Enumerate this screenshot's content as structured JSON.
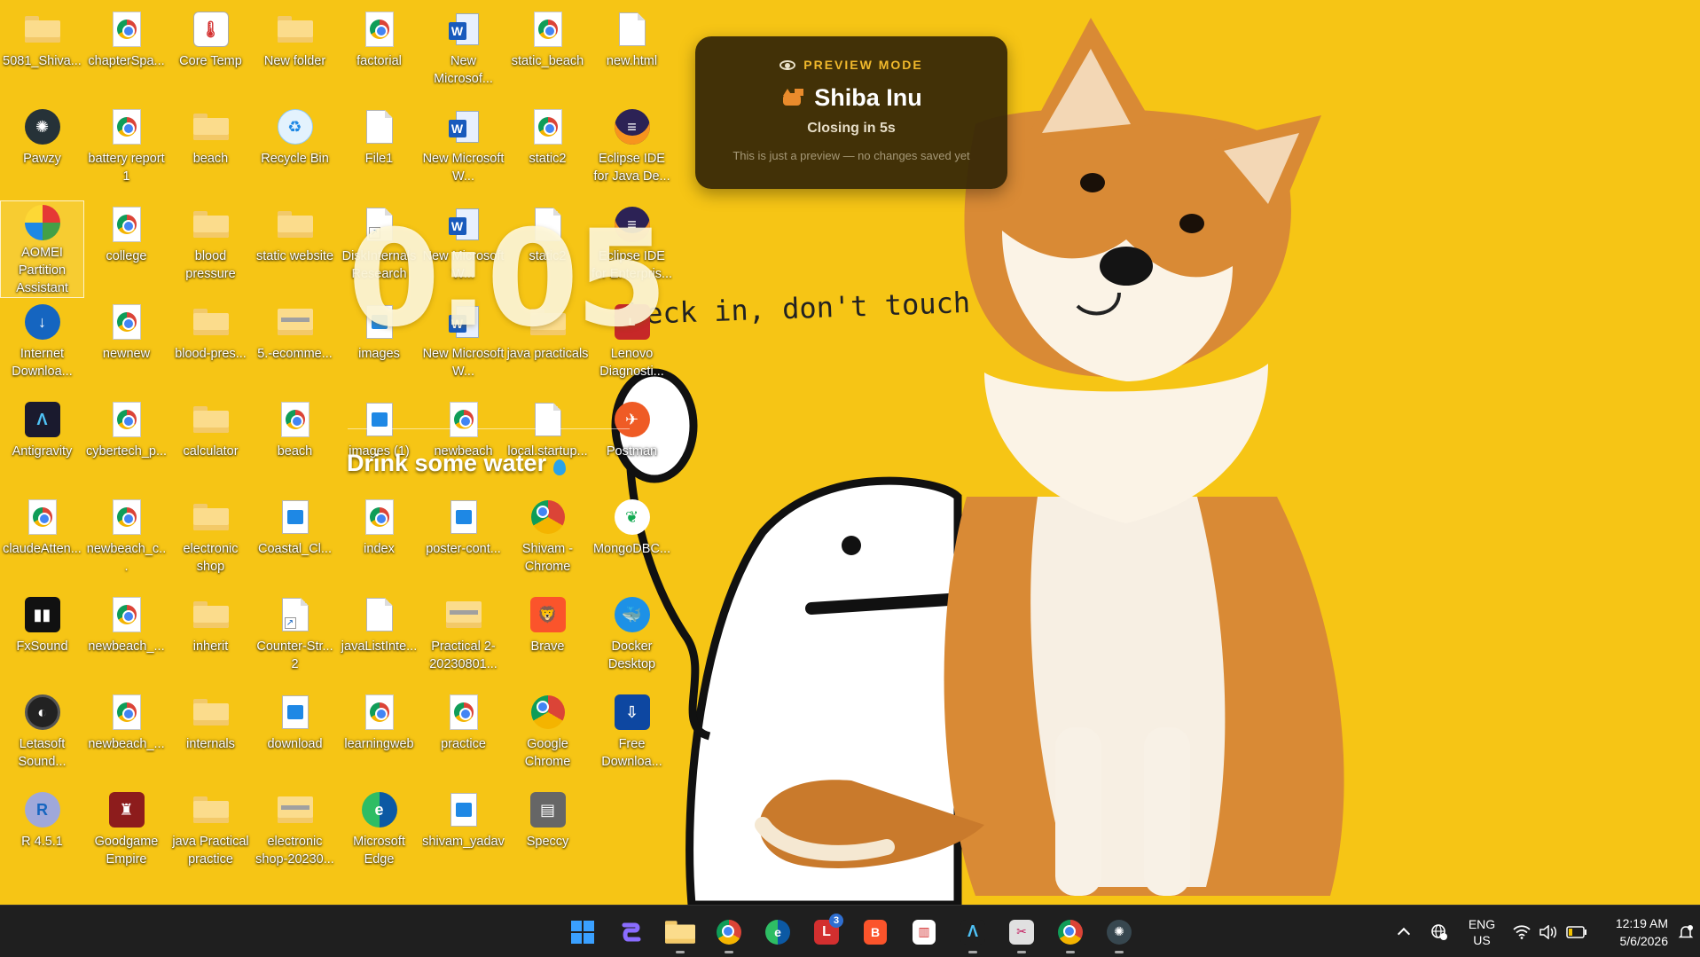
{
  "desktop": {
    "icons": [
      {
        "label": "5081_Shiva...",
        "glyph": "folder"
      },
      {
        "label": "chapterSpa...",
        "glyph": "chrome-doc"
      },
      {
        "label": "Core Temp",
        "glyph": "coretemp"
      },
      {
        "label": "New folder",
        "glyph": "folder"
      },
      {
        "label": "factorial",
        "glyph": "chrome-doc"
      },
      {
        "label": "New Microsof...",
        "glyph": "word"
      },
      {
        "label": "static_beach",
        "glyph": "chrome-doc"
      },
      {
        "label": "new.html",
        "glyph": "doc"
      },
      {
        "label": "Pawzy",
        "glyph": "pawzy"
      },
      {
        "label": "battery report 1",
        "glyph": "chrome-doc"
      },
      {
        "label": "beach",
        "glyph": "folder"
      },
      {
        "label": "Recycle Bin",
        "glyph": "recycle"
      },
      {
        "label": "File1",
        "glyph": "doc"
      },
      {
        "label": "New Microsoft W...",
        "glyph": "word"
      },
      {
        "label": "static2",
        "glyph": "chrome-doc"
      },
      {
        "label": "Eclipse IDE for Java De...",
        "glyph": "eclipse"
      },
      {
        "label": "AOMEI Partition Assistant 10.10.1",
        "glyph": "aomei",
        "selected": true
      },
      {
        "label": "college",
        "glyph": "chrome-doc"
      },
      {
        "label": "blood pressure",
        "glyph": "folder"
      },
      {
        "label": "static website",
        "glyph": "folder"
      },
      {
        "label": "DiskInternals Research",
        "glyph": "doc-link"
      },
      {
        "label": "New Microsoft W...",
        "glyph": "word"
      },
      {
        "label": "static2",
        "glyph": "doc"
      },
      {
        "label": "Eclipse IDE for Enterpris...",
        "glyph": "eclipse"
      },
      {
        "label": "Internet Downloa...",
        "glyph": "idm"
      },
      {
        "label": "newnew",
        "glyph": "chrome-doc"
      },
      {
        "label": "blood-pres...",
        "glyph": "folder"
      },
      {
        "label": "5.-ecomme...",
        "glyph": "zip"
      },
      {
        "label": "images",
        "glyph": "img-doc"
      },
      {
        "label": "New Microsoft W...",
        "glyph": "word"
      },
      {
        "label": "java practicals",
        "glyph": "folder"
      },
      {
        "label": "Lenovo Diagnosti...",
        "glyph": "lenovo"
      },
      {
        "label": "Antigravity",
        "glyph": "antigravity"
      },
      {
        "label": "cybertech_p...",
        "glyph": "chrome-doc"
      },
      {
        "label": "calculator",
        "glyph": "folder"
      },
      {
        "label": "beach",
        "glyph": "chrome-doc"
      },
      {
        "label": "images (1)",
        "glyph": "img-doc"
      },
      {
        "label": "newbeach",
        "glyph": "chrome-doc"
      },
      {
        "label": "local.startup...",
        "glyph": "doc"
      },
      {
        "label": "Postman",
        "glyph": "postman"
      },
      {
        "label": "claudeAtten...",
        "glyph": "chrome-doc"
      },
      {
        "label": "newbeach_c...",
        "glyph": "chrome-doc"
      },
      {
        "label": "electronic shop",
        "glyph": "folder"
      },
      {
        "label": "Coastal_Cl...",
        "glyph": "img-doc"
      },
      {
        "label": "index",
        "glyph": "chrome-doc"
      },
      {
        "label": "poster-cont...",
        "glyph": "img-doc"
      },
      {
        "label": "Shivam - Chrome",
        "glyph": "chrome-app"
      },
      {
        "label": "MongoDBC...",
        "glyph": "mongo"
      },
      {
        "label": "FxSound",
        "glyph": "fxsound"
      },
      {
        "label": "newbeach_...",
        "glyph": "chrome-doc"
      },
      {
        "label": "inherit",
        "glyph": "folder"
      },
      {
        "label": "Counter-Str... 2",
        "glyph": "doc-link"
      },
      {
        "label": "javaListInte...",
        "glyph": "doc"
      },
      {
        "label": "Practical 2-20230801...",
        "glyph": "zip"
      },
      {
        "label": "Brave",
        "glyph": "brave"
      },
      {
        "label": "Docker Desktop",
        "glyph": "docker"
      },
      {
        "label": "Letasoft Sound...",
        "glyph": "letasoft"
      },
      {
        "label": "newbeach_...",
        "glyph": "chrome-doc"
      },
      {
        "label": "internals",
        "glyph": "folder"
      },
      {
        "label": "download",
        "glyph": "img-doc"
      },
      {
        "label": "learningweb",
        "glyph": "chrome-doc"
      },
      {
        "label": "practice",
        "glyph": "chrome-doc"
      },
      {
        "label": "Google Chrome",
        "glyph": "chrome-app"
      },
      {
        "label": "Free Downloa...",
        "glyph": "fdm"
      },
      {
        "label": "R 4.5.1",
        "glyph": "rlang"
      },
      {
        "label": "Goodgame Empire",
        "glyph": "goodgame"
      },
      {
        "label": "java Practical practice",
        "glyph": "folder"
      },
      {
        "label": "electronic shop-20230...",
        "glyph": "zip"
      },
      {
        "label": "Microsoft Edge",
        "glyph": "edge"
      },
      {
        "label": "shivam_yadav",
        "glyph": "img-doc"
      },
      {
        "label": "Speccy",
        "glyph": "speccy"
      }
    ]
  },
  "wallpaper": {
    "handwriting": "check in, don't touch a"
  },
  "overlay": {
    "clock": "0:05",
    "reminder": "Drink some water"
  },
  "preview": {
    "mode": "PREVIEW MODE",
    "title": "Shiba Inu",
    "closing": "Closing in 5s",
    "note": "This is just a preview — no changes saved yet"
  },
  "taskbar": {
    "apps": [
      {
        "name": "start-button",
        "icon": "windows-logo"
      },
      {
        "name": "copilot",
        "icon": "copilot-icon"
      },
      {
        "name": "file-explorer",
        "icon": "folder-icon",
        "running": true
      },
      {
        "name": "chrome-profile",
        "icon": "chrome-icon",
        "running": true
      },
      {
        "name": "edge",
        "icon": "edge-icon"
      },
      {
        "name": "lenovo-vantage",
        "icon": "lenovo-icon",
        "badge": "3"
      },
      {
        "name": "brave",
        "icon": "brave-icon"
      },
      {
        "name": "core-temp",
        "icon": "coretemp-icon"
      },
      {
        "name": "antigravity",
        "icon": "antigravity-icon",
        "running": true
      },
      {
        "name": "snipping-tool",
        "icon": "snipping-icon",
        "running": true
      },
      {
        "name": "chrome",
        "icon": "chrome-icon",
        "running": true
      },
      {
        "name": "pawzy",
        "icon": "pawzy-icon",
        "running": true
      }
    ],
    "tray": {
      "lang_top": "ENG",
      "lang_bottom": "US",
      "time": "12:19 AM",
      "date": "5/6/2026"
    }
  },
  "colors": {
    "wallpaper": "#f6c515",
    "taskbar": "#1f1f1f",
    "toast": "#342606",
    "toast_accent": "#f1b92c"
  }
}
